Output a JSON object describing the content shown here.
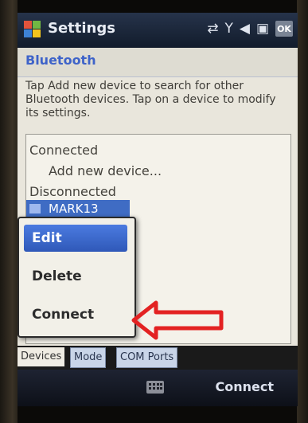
{
  "title_bar": {
    "title": "Settings",
    "status_icons": [
      "sync-icon",
      "signal-off-icon",
      "volume-icon",
      "battery-icon"
    ],
    "ok_label": "OK"
  },
  "section": {
    "title": "Bluetooth"
  },
  "description": "Tap Add new device to search for other Bluetooth devices. Tap on a device to modify its settings.",
  "device_list": {
    "connected_header": "Connected",
    "add_device": "Add new device...",
    "disconnected_header": "Disconnected",
    "selected_device": "MARK13"
  },
  "context_menu": {
    "items": [
      {
        "label": "Edit"
      },
      {
        "label": "Delete"
      },
      {
        "label": "Connect"
      }
    ]
  },
  "tabs": [
    {
      "label": "Devices"
    },
    {
      "label": "Mode"
    },
    {
      "label": "COM Ports"
    }
  ],
  "softkeys": {
    "right": "Connect"
  },
  "colors": {
    "selection": "#3f6cc4",
    "annotation_arrow": "#e32222",
    "header_text": "#3e63c9"
  }
}
